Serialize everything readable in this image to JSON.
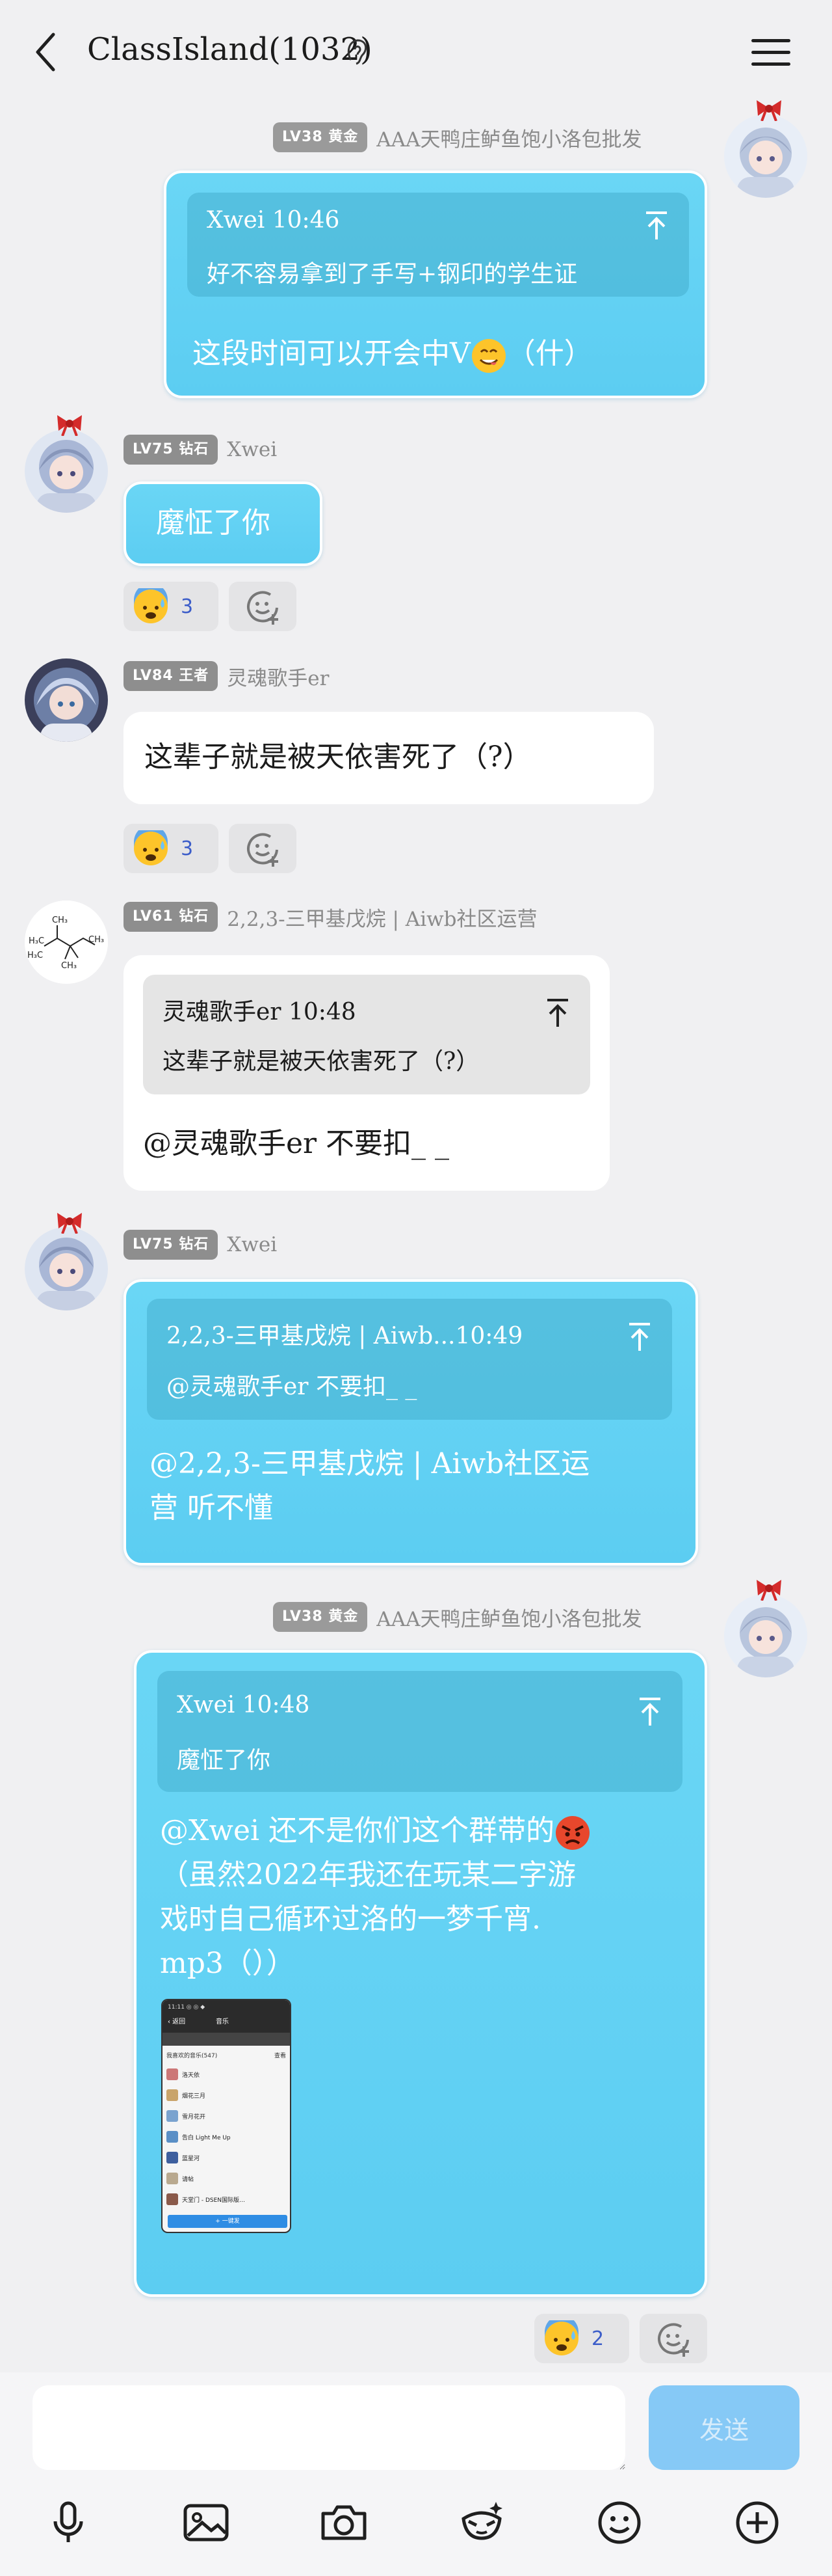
{
  "header": {
    "title": "ClassIsland(1032)"
  },
  "messages": [
    {
      "side": "right",
      "badge": "LV38 黄金",
      "sender": "AAA天鸭庄鲈鱼饱小洛包批发",
      "quote": {
        "head": "Xwei 10:46",
        "body": "好不容易拿到了手写+钢印的学生证"
      },
      "text": "这段时间可以开会中V",
      "text_tail": "（什）"
    },
    {
      "side": "left",
      "badge": "LV75 钻石",
      "sender": "Xwei",
      "text": "魔怔了你",
      "reaction_count": "3"
    },
    {
      "side": "left",
      "badge": "LV84 王者",
      "sender": "灵魂歌手er",
      "text": "这辈子就是被天依害死了（?）",
      "reaction_count": "3"
    },
    {
      "side": "left",
      "badge": "LV61 钻石",
      "sender": "2,2,3-三甲基戊烷 | Aiwb社区运营",
      "quote": {
        "head": "灵魂歌手er 10:48",
        "body": "这辈子就是被天依害死了（?）"
      },
      "text": "@灵魂歌手er 不要扣_ _"
    },
    {
      "side": "left",
      "badge": "LV75 钻石",
      "sender": "Xwei",
      "quote": {
        "head": "2,2,3-三甲基戊烷 | Aiwb...10:49",
        "body": "@灵魂歌手er 不要扣_ _"
      },
      "text_line1": "@2,2,3-三甲基戊烷 | Aiwb社区运",
      "text_line2": "营 听不懂"
    },
    {
      "side": "right",
      "badge": "LV38 黄金",
      "sender": "AAA天鸭庄鲈鱼饱小洛包批发",
      "quote": {
        "head": "Xwei 10:48",
        "body": "魔怔了你"
      },
      "text_line1": "@Xwei 还不是你们这个群带的",
      "text_line2": "（虽然2022年我还在玩某二字游",
      "text_line3": "戏时自己循环过洛的一梦千宵.",
      "text_line4": "mp3（））",
      "reaction_count": "2"
    }
  ],
  "thumb": {
    "status": "11:11 ◎ ◎ ◆",
    "nav": "‹ 返回",
    "tab": "音乐",
    "section": "我喜欢的音乐(547)",
    "more": "查看",
    "items": [
      "洛天依",
      "烟花三月",
      "雪月花开",
      "告白 Light Me Up",
      "蓝星河",
      "请帖",
      "天堂门 - DSEN国际版…"
    ],
    "button": "+ 一键发"
  },
  "composer": {
    "placeholder": "",
    "send_label": "发送"
  },
  "toolbar": [
    "mic-icon",
    "image-icon",
    "camera-icon",
    "sticker-icon",
    "emoji-icon",
    "plus-icon"
  ]
}
